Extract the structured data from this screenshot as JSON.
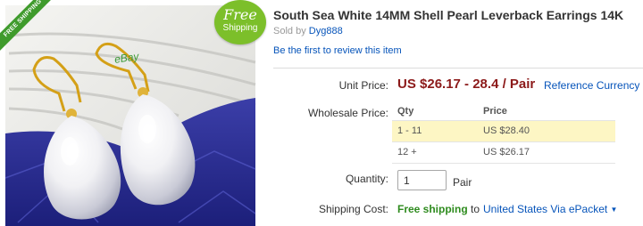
{
  "photo": {
    "ribbon": "FREE SHIPPING",
    "watermark": "eBay",
    "badge_big": "Free",
    "badge_small": "Shipping"
  },
  "product": {
    "title": "South Sea White 14MM Shell Pearl Leverback Earrings 14K",
    "sold_by_label": "Sold by",
    "seller": "Dyg888",
    "review_link": "Be the first to review this item"
  },
  "pricing": {
    "unit_price_label": "Unit Price:",
    "price_range": "US $26.17 - 28.4 / Pair",
    "reference_currency": "Reference Currency",
    "wholesale_label": "Wholesale Price:",
    "table_headers": [
      "Qty",
      "Price"
    ],
    "tiers": [
      {
        "qty": "1 - 11",
        "price": "US $28.40"
      },
      {
        "qty": "12 +",
        "price": "US $26.17"
      }
    ]
  },
  "quantity": {
    "label": "Quantity:",
    "value": "1",
    "unit": "Pair"
  },
  "shipping": {
    "label": "Shipping Cost:",
    "free": "Free shipping",
    "to": "to",
    "destination": "United States Via ePacket"
  },
  "colors": {
    "price": "#8c1a1a",
    "link": "#0654ba",
    "free_shipping": "#2e8b1e",
    "highlight_row": "#fdf6c4",
    "badge": "#7cbf2a"
  }
}
